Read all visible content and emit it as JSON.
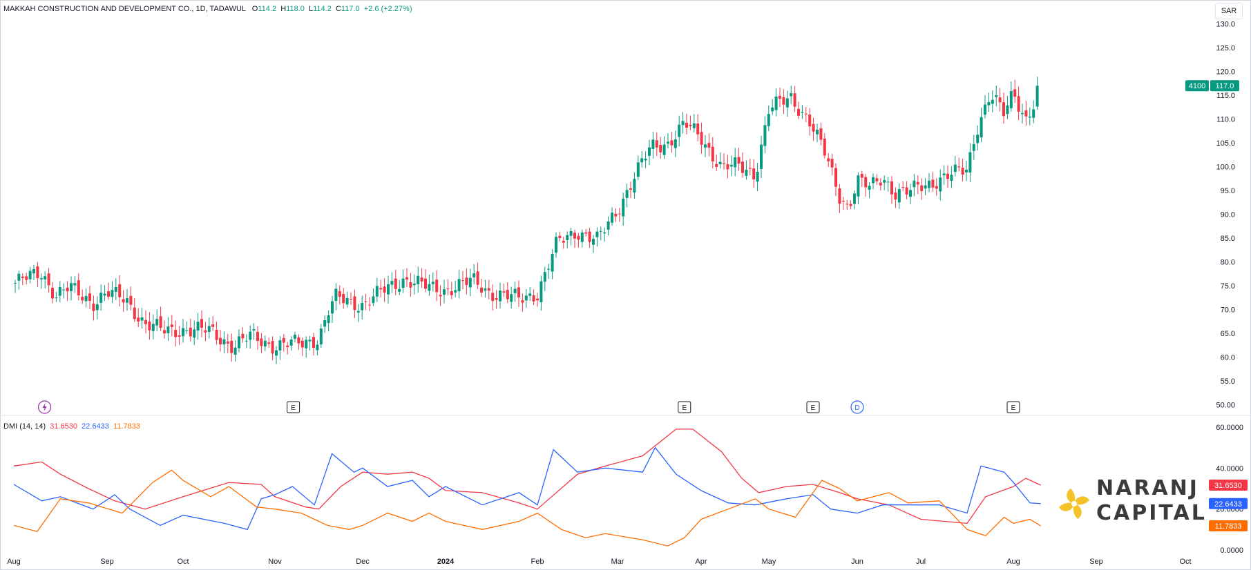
{
  "header": {
    "symbol": "MAKKAH CONSTRUCTION AND DEVELOPMENT CO., 1D, TADAWUL",
    "o_label": "O",
    "o_value": "114.2",
    "h_label": "H",
    "h_value": "118.0",
    "l_label": "L",
    "l_value": "114.2",
    "c_label": "C",
    "c_value": "117.0",
    "change": "+2.6 (+2.27%)"
  },
  "currency_button": "SAR",
  "price_tag": {
    "symbol": "4100",
    "value": "117.0"
  },
  "events": [
    {
      "kind": "E",
      "month": "Oct",
      "fraction": 1.2
    },
    {
      "kind": "E",
      "month": "Mar",
      "fraction": 0.8
    },
    {
      "kind": "E",
      "month": "May",
      "fraction": 0.5
    },
    {
      "kind": "D",
      "month": "Jun",
      "fraction": 0.0
    },
    {
      "kind": "E",
      "month": "Jul",
      "fraction": 1.0
    },
    {
      "kind": "lightning-icon",
      "month": "Aug",
      "fraction": 0.33
    }
  ],
  "dmi": {
    "label": "DMI (14, 14)",
    "plus_di": "31.6530",
    "minus_di": "22.6433",
    "adx": "11.7833"
  },
  "logo": {
    "line1": "NARANJ",
    "line2": "CAPITAL"
  },
  "chart_data": [
    {
      "type": "candlestick",
      "title": "MAKKAH CONSTRUCTION AND DEVELOPMENT CO., 1D, TADAWUL",
      "x_tick_labels": [
        "Aug",
        "Sep",
        "Oct",
        "Nov",
        "Dec",
        "2024",
        "Feb",
        "Mar",
        "Apr",
        "May",
        "Jun",
        "Jul",
        "Aug",
        "Sep",
        "Oct"
      ],
      "y_ticks": [
        50,
        55,
        60,
        65,
        70,
        75,
        80,
        85,
        90,
        95,
        100,
        105,
        110,
        115,
        120,
        125,
        130
      ],
      "y_tick_labels": [
        "50.00",
        "55.0",
        "60.0",
        "65.0",
        "70.0",
        "75.0",
        "80.0",
        "85.0",
        "90.0",
        "95.0",
        "100.0",
        "105.0",
        "110.0",
        "115.0",
        "120.0",
        "125.0",
        "130.0"
      ],
      "ylim": [
        49.5,
        135
      ],
      "up_color": "#089981",
      "down_color": "#f23645",
      "close_anchors": [
        [
          "Aug",
          0.0,
          75.5
        ],
        [
          "Aug",
          0.3,
          77.8
        ],
        [
          "Aug",
          0.45,
          73.0
        ],
        [
          "Aug",
          0.6,
          74.5
        ],
        [
          "Aug",
          0.85,
          71.5
        ],
        [
          "Sep",
          0.0,
          73.5
        ],
        [
          "Sep",
          0.25,
          72.0
        ],
        [
          "Sep",
          0.5,
          67.0
        ],
        [
          "Sep",
          0.75,
          65.5
        ],
        [
          "Oct",
          0.0,
          65.8
        ],
        [
          "Oct",
          0.3,
          65.5
        ],
        [
          "Oct",
          0.55,
          62.2
        ],
        [
          "Oct",
          0.75,
          64.5
        ],
        [
          "Nov",
          0.0,
          62.3
        ],
        [
          "Nov",
          0.3,
          63.0
        ],
        [
          "Nov",
          0.5,
          64.0
        ],
        [
          "Nov",
          0.62,
          70.0
        ],
        [
          "Nov",
          0.7,
          72.5
        ],
        [
          "Nov",
          0.9,
          71.5
        ],
        [
          "Dec",
          0.0,
          71.0
        ],
        [
          "Dec",
          0.3,
          74.5
        ],
        [
          "Dec",
          0.5,
          76.5
        ],
        [
          "Dec",
          0.8,
          74.5
        ],
        [
          "2024",
          0.0,
          74.2
        ],
        [
          "2024",
          0.3,
          76.0
        ],
        [
          "2024",
          0.5,
          73.5
        ],
        [
          "2024",
          0.8,
          72.2
        ],
        [
          "Feb",
          0.0,
          73.5
        ],
        [
          "Feb",
          0.25,
          84.0
        ],
        [
          "Feb",
          0.5,
          86.5
        ],
        [
          "Feb",
          0.75,
          84.5
        ],
        [
          "Feb",
          0.85,
          87.0
        ],
        [
          "Mar",
          0.0,
          91.0
        ],
        [
          "Mar",
          0.2,
          98.0
        ],
        [
          "Mar",
          0.4,
          104.0
        ],
        [
          "Mar",
          0.6,
          105.0
        ],
        [
          "Mar",
          0.8,
          109.0
        ],
        [
          "Apr",
          0.0,
          106.0
        ],
        [
          "Apr",
          0.3,
          100.0
        ],
        [
          "Apr",
          0.55,
          100.0
        ],
        [
          "Apr",
          0.8,
          98.5
        ],
        [
          "May",
          0.0,
          112.0
        ],
        [
          "May",
          0.25,
          114.5
        ],
        [
          "May",
          0.45,
          110.0
        ],
        [
          "May",
          0.65,
          102.0
        ],
        [
          "May",
          0.8,
          94.0
        ],
        [
          "May",
          0.9,
          91.5
        ],
        [
          "Jun",
          0.0,
          97.0
        ],
        [
          "Jun",
          0.2,
          95.5
        ],
        [
          "Jun",
          0.4,
          98.0
        ],
        [
          "Jun",
          0.6,
          94.5
        ],
        [
          "Jun",
          0.8,
          94.5
        ],
        [
          "Jul",
          0.0,
          96.0
        ],
        [
          "Jul",
          0.3,
          98.0
        ],
        [
          "Jul",
          0.5,
          99.5
        ],
        [
          "Jul",
          0.6,
          108.0
        ],
        [
          "Jul",
          0.75,
          115.0
        ],
        [
          "Jul",
          0.9,
          111.0
        ],
        [
          "Aug",
          0.0,
          116.0
        ],
        [
          "Aug",
          0.15,
          110.0
        ],
        [
          "Aug",
          0.25,
          113.0
        ],
        [
          "Aug",
          0.33,
          117.0
        ]
      ],
      "last_close": 117.0
    },
    {
      "type": "line",
      "title": "DMI (14, 14)",
      "y_ticks": [
        0,
        20,
        40,
        60
      ],
      "y_tick_labels": [
        "0.0000",
        "20.0000",
        "40.0000",
        "60.0000"
      ],
      "ylim": [
        -1,
        63
      ],
      "series": [
        {
          "name": "+DI",
          "color": "#f23645",
          "last": 31.653,
          "points": [
            [
              "Aug",
              0.0,
              41
            ],
            [
              "Aug",
              0.3,
              43
            ],
            [
              "Aug",
              0.5,
              37
            ],
            [
              "Aug",
              0.8,
              30
            ],
            [
              "Sep",
              0.1,
              24
            ],
            [
              "Sep",
              0.5,
              20
            ],
            [
              "Oct",
              0.0,
              26
            ],
            [
              "Oct",
              0.5,
              33
            ],
            [
              "Oct",
              0.85,
              32
            ],
            [
              "Nov",
              0.0,
              26
            ],
            [
              "Nov",
              0.35,
              21
            ],
            [
              "Nov",
              0.5,
              20
            ],
            [
              "Nov",
              0.75,
              31
            ],
            [
              "Dec",
              0.0,
              38
            ],
            [
              "Dec",
              0.3,
              37
            ],
            [
              "Dec",
              0.6,
              38
            ],
            [
              "Dec",
              0.8,
              35
            ],
            [
              "2024",
              0.0,
              29
            ],
            [
              "2024",
              0.4,
              28
            ],
            [
              "2024",
              0.8,
              23
            ],
            [
              "Feb",
              0.0,
              20
            ],
            [
              "Feb",
              0.5,
              37
            ],
            [
              "Feb",
              0.85,
              41
            ],
            [
              "Mar",
              0.3,
              46
            ],
            [
              "Mar",
              0.7,
              59
            ],
            [
              "Mar",
              0.9,
              59
            ],
            [
              "Apr",
              0.3,
              48
            ],
            [
              "Apr",
              0.6,
              35
            ],
            [
              "Apr",
              0.85,
              28
            ],
            [
              "May",
              0.2,
              31
            ],
            [
              "May",
              0.5,
              32
            ],
            [
              "May",
              0.8,
              28
            ],
            [
              "Jun",
              0.0,
              25
            ],
            [
              "Jun",
              0.5,
              22
            ],
            [
              "Jul",
              0.0,
              15
            ],
            [
              "Jul",
              0.5,
              13
            ],
            [
              "Jul",
              0.7,
              26
            ],
            [
              "Aug",
              0.0,
              31
            ],
            [
              "Aug",
              0.15,
              35
            ],
            [
              "Aug",
              0.33,
              31.65
            ]
          ]
        },
        {
          "name": "-DI",
          "color": "#2962ff",
          "last": 22.6433,
          "points": [
            [
              "Aug",
              0.0,
              32
            ],
            [
              "Aug",
              0.3,
              24
            ],
            [
              "Aug",
              0.5,
              26
            ],
            [
              "Aug",
              0.85,
              20
            ],
            [
              "Sep",
              0.1,
              27
            ],
            [
              "Sep",
              0.3,
              20
            ],
            [
              "Sep",
              0.7,
              12
            ],
            [
              "Oct",
              0.0,
              17
            ],
            [
              "Oct",
              0.45,
              13
            ],
            [
              "Oct",
              0.7,
              10
            ],
            [
              "Oct",
              0.85,
              25
            ],
            [
              "Nov",
              0.0,
              27
            ],
            [
              "Nov",
              0.2,
              31
            ],
            [
              "Nov",
              0.45,
              22
            ],
            [
              "Nov",
              0.65,
              47
            ],
            [
              "Nov",
              0.9,
              38
            ],
            [
              "Dec",
              0.0,
              40
            ],
            [
              "Dec",
              0.3,
              31
            ],
            [
              "Dec",
              0.6,
              34
            ],
            [
              "Dec",
              0.8,
              26
            ],
            [
              "2024",
              0.0,
              31
            ],
            [
              "2024",
              0.4,
              22
            ],
            [
              "2024",
              0.8,
              28
            ],
            [
              "Feb",
              0.0,
              22
            ],
            [
              "Feb",
              0.2,
              49
            ],
            [
              "Feb",
              0.5,
              38
            ],
            [
              "Feb",
              0.85,
              40
            ],
            [
              "Mar",
              0.3,
              38
            ],
            [
              "Mar",
              0.45,
              50
            ],
            [
              "Mar",
              0.7,
              37
            ],
            [
              "Apr",
              0.0,
              29
            ],
            [
              "Apr",
              0.4,
              23
            ],
            [
              "Apr",
              0.8,
              22
            ],
            [
              "May",
              0.2,
              25
            ],
            [
              "May",
              0.5,
              27
            ],
            [
              "May",
              0.7,
              20
            ],
            [
              "Jun",
              0.0,
              18
            ],
            [
              "Jun",
              0.4,
              22
            ],
            [
              "Jun",
              0.8,
              22
            ],
            [
              "Jul",
              0.2,
              22
            ],
            [
              "Jul",
              0.5,
              18
            ],
            [
              "Jul",
              0.65,
              41
            ],
            [
              "Jul",
              0.9,
              38
            ],
            [
              "Aug",
              0.0,
              33
            ],
            [
              "Aug",
              0.2,
              23
            ],
            [
              "Aug",
              0.33,
              22.64
            ]
          ]
        },
        {
          "name": "ADX",
          "color": "#ff6d00",
          "last": 11.7833,
          "points": [
            [
              "Aug",
              0.0,
              12
            ],
            [
              "Aug",
              0.25,
              9
            ],
            [
              "Aug",
              0.5,
              25
            ],
            [
              "Aug",
              0.8,
              23
            ],
            [
              "Sep",
              0.2,
              18
            ],
            [
              "Sep",
              0.6,
              33
            ],
            [
              "Sep",
              0.85,
              39
            ],
            [
              "Oct",
              0.0,
              34
            ],
            [
              "Oct",
              0.3,
              26
            ],
            [
              "Oct",
              0.5,
              31
            ],
            [
              "Oct",
              0.8,
              21
            ],
            [
              "Nov",
              0.0,
              20
            ],
            [
              "Nov",
              0.3,
              18
            ],
            [
              "Nov",
              0.6,
              12
            ],
            [
              "Nov",
              0.85,
              10
            ],
            [
              "Dec",
              0.0,
              12
            ],
            [
              "Dec",
              0.3,
              18
            ],
            [
              "Dec",
              0.6,
              14
            ],
            [
              "Dec",
              0.8,
              18
            ],
            [
              "2024",
              0.0,
              14
            ],
            [
              "2024",
              0.4,
              10
            ],
            [
              "2024",
              0.8,
              14
            ],
            [
              "Feb",
              0.0,
              18
            ],
            [
              "Feb",
              0.3,
              10
            ],
            [
              "Feb",
              0.6,
              6
            ],
            [
              "Feb",
              0.85,
              8
            ],
            [
              "Mar",
              0.3,
              5
            ],
            [
              "Mar",
              0.6,
              2
            ],
            [
              "Mar",
              0.8,
              6
            ],
            [
              "Apr",
              0.0,
              15
            ],
            [
              "Apr",
              0.4,
              20
            ],
            [
              "Apr",
              0.8,
              25
            ],
            [
              "May",
              0.0,
              20
            ],
            [
              "May",
              0.3,
              16
            ],
            [
              "May",
              0.6,
              34
            ],
            [
              "May",
              0.8,
              30
            ],
            [
              "Jun",
              0.0,
              24
            ],
            [
              "Jun",
              0.5,
              28
            ],
            [
              "Jun",
              0.8,
              23
            ],
            [
              "Jul",
              0.2,
              24
            ],
            [
              "Jul",
              0.5,
              10
            ],
            [
              "Jul",
              0.7,
              7
            ],
            [
              "Jul",
              0.9,
              16
            ],
            [
              "Aug",
              0.0,
              13
            ],
            [
              "Aug",
              0.2,
              15
            ],
            [
              "Aug",
              0.33,
              11.78
            ]
          ]
        }
      ]
    }
  ]
}
